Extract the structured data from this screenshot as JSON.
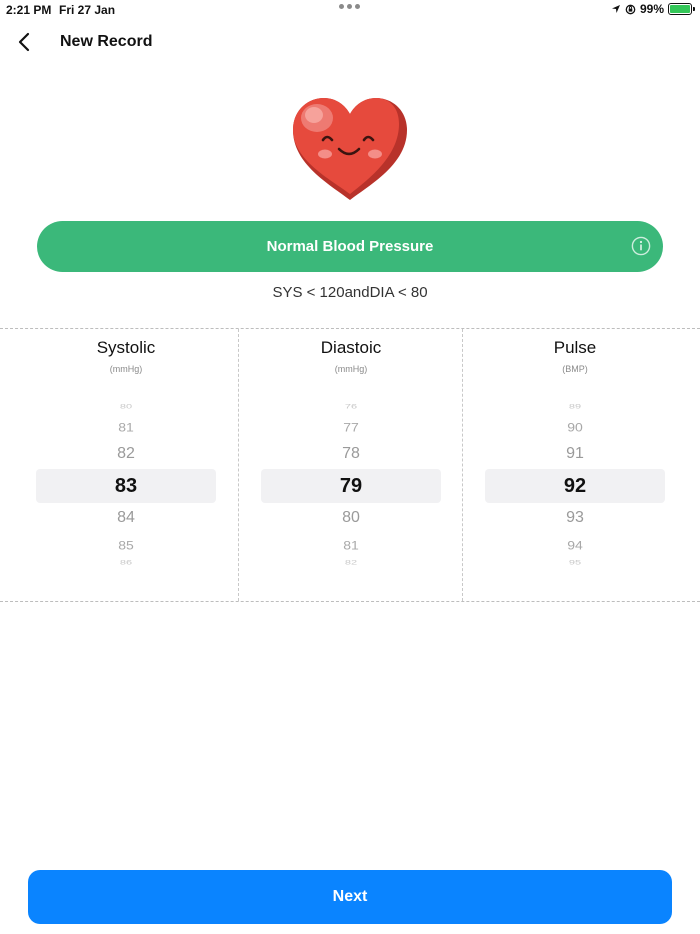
{
  "status_bar": {
    "time": "2:21 PM",
    "date": "Fri 27 Jan",
    "battery": "99%"
  },
  "nav": {
    "title": "New Record"
  },
  "status": {
    "label": "Normal Blood Pressure",
    "range_text": "SYS < 120andDIA < 80",
    "color": "#3bb87a"
  },
  "pickers": [
    {
      "title": "Systolic",
      "unit": "(mmHg)",
      "values": [
        "80",
        "81",
        "82",
        "83",
        "84",
        "85",
        "86"
      ],
      "selected": "83"
    },
    {
      "title": "Diastoic",
      "unit": "(mmHg)",
      "values": [
        "76",
        "77",
        "78",
        "79",
        "80",
        "81",
        "82"
      ],
      "selected": "79"
    },
    {
      "title": "Pulse",
      "unit": "(BMP)",
      "values": [
        "89",
        "90",
        "91",
        "92",
        "93",
        "94",
        "95"
      ],
      "selected": "92"
    }
  ],
  "next_button": {
    "label": "Next",
    "color": "#0a84ff"
  },
  "icons": {
    "back": "chevron-left-icon",
    "info": "info-icon",
    "location": "location-arrow-icon",
    "lock": "orientation-lock-icon",
    "battery": "battery-charging-icon"
  }
}
